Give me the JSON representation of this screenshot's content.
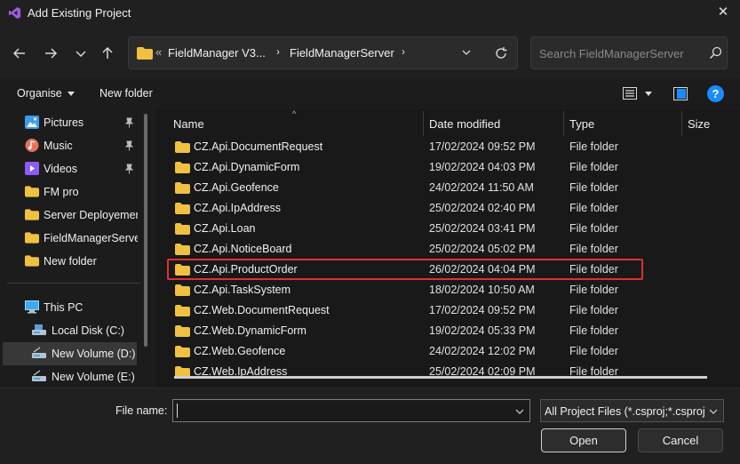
{
  "window": {
    "title": "Add Existing Project",
    "close_glyph": "✕"
  },
  "address": {
    "overflow": "«",
    "segments": [
      "FieldManager V3...",
      "FieldManagerServer"
    ],
    "separator": "›"
  },
  "search": {
    "placeholder": "Search FieldManagerServer"
  },
  "toolbar": {
    "organise_label": "Organise",
    "new_folder_label": "New folder",
    "help_label": "?"
  },
  "nav": {
    "quick_access": [
      {
        "label": "Pictures",
        "icon": "pictures-icon",
        "pinned": true
      },
      {
        "label": "Music",
        "icon": "music-icon",
        "pinned": true
      },
      {
        "label": "Videos",
        "icon": "videos-icon",
        "pinned": true
      },
      {
        "label": "FM pro",
        "icon": "folder-icon",
        "pinned": false
      },
      {
        "label": "Server Deployement",
        "icon": "folder-icon",
        "pinned": false
      },
      {
        "label": "FieldManagerServer",
        "icon": "folder-icon",
        "pinned": false
      },
      {
        "label": "New folder",
        "icon": "folder-icon",
        "pinned": false
      }
    ],
    "this_pc": {
      "label": "This PC",
      "icon": "computer-icon"
    },
    "drives": [
      {
        "label": "Local Disk (C:)",
        "icon": "drive-icon",
        "selected": false
      },
      {
        "label": "New Volume (D:)",
        "icon": "drive-icon",
        "selected": true
      },
      {
        "label": "New Volume (E:)",
        "icon": "drive-icon",
        "selected": false
      }
    ]
  },
  "columns": {
    "name": "Name",
    "date": "Date modified",
    "type": "Type",
    "size": "Size"
  },
  "files": [
    {
      "name": "CZ.Api.DocumentRequest",
      "date": "17/02/2024 09:52 PM",
      "type": "File folder"
    },
    {
      "name": "CZ.Api.DynamicForm",
      "date": "19/02/2024 04:03 PM",
      "type": "File folder"
    },
    {
      "name": "CZ.Api.Geofence",
      "date": "24/02/2024 11:50 AM",
      "type": "File folder"
    },
    {
      "name": "CZ.Api.IpAddress",
      "date": "25/02/2024 02:40 PM",
      "type": "File folder"
    },
    {
      "name": "CZ.Api.Loan",
      "date": "25/02/2024 03:41 PM",
      "type": "File folder"
    },
    {
      "name": "CZ.Api.NoticeBoard",
      "date": "25/02/2024 05:02 PM",
      "type": "File folder"
    },
    {
      "name": "CZ.Api.ProductOrder",
      "date": "26/02/2024 04:04 PM",
      "type": "File folder"
    },
    {
      "name": "CZ.Api.TaskSystem",
      "date": "18/02/2024 10:50 AM",
      "type": "File folder"
    },
    {
      "name": "CZ.Web.DocumentRequest",
      "date": "17/02/2024 09:52 PM",
      "type": "File folder"
    },
    {
      "name": "CZ.Web.DynamicForm",
      "date": "19/02/2024 05:33 PM",
      "type": "File folder"
    },
    {
      "name": "CZ.Web.Geofence",
      "date": "24/02/2024 12:02 PM",
      "type": "File folder"
    },
    {
      "name": "CZ.Web.IpAddress",
      "date": "25/02/2024 02:09 PM",
      "type": "File folder"
    }
  ],
  "highlighted_file": "CZ.Api.ProductOrder",
  "bottom": {
    "file_name_label": "File name:",
    "file_name_value": "",
    "filter": "All Project Files (*.csproj;*.csproj)",
    "open_label": "Open",
    "cancel_label": "Cancel"
  },
  "colors": {
    "folder": "#f0c040",
    "accent": "#1a8cff",
    "highlight": "#e03030"
  }
}
